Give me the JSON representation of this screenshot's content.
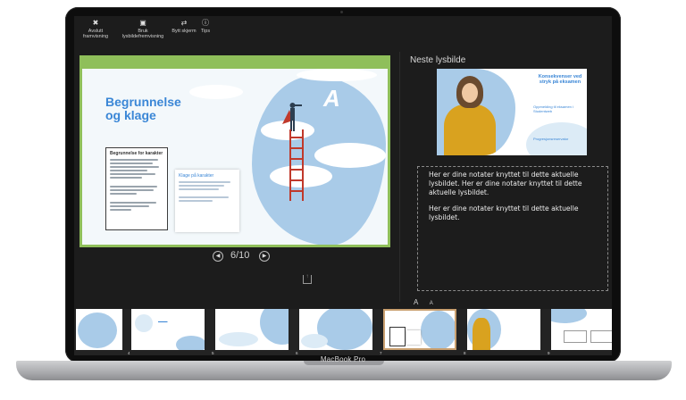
{
  "toolbar": {
    "items": [
      {
        "label": "Avslutt framvisning",
        "icon": "close-circle-icon"
      },
      {
        "label": "Bruk lysbildefremvisning",
        "icon": "screens-icon"
      },
      {
        "label": "Bytt skjerm",
        "icon": "swap-icon"
      },
      {
        "label": "Tips",
        "icon": "info-icon"
      }
    ]
  },
  "current_slide": {
    "title": "Begrunnelse og klage",
    "box1_title": "Begrunnelse for karakter",
    "box2_title": "Klage på karakter"
  },
  "navigation": {
    "position": "6/10",
    "prev_symbol": "◀",
    "next_symbol": "▶"
  },
  "next_slide": {
    "label": "Neste lysbilde",
    "title": "Konsekvenser ved stryk på eksamen",
    "subtitle1": "Oppmelding til eksamen i Studentweb",
    "subtitle2": "Progresjonsreservator"
  },
  "notes": {
    "paragraph1": "Her er dine notater knyttet til dette aktuelle lysbildet. Her er dine notater knyttet til dette aktuelle lysbildet.",
    "paragraph2": "Her er dine notater knyttet til dette aktuelle lysbildet."
  },
  "font_controls": {
    "larger": "A",
    "smaller": "A"
  },
  "filmstrip": {
    "numbers": [
      "",
      "4",
      "5",
      "6",
      "7",
      "8",
      "9",
      ""
    ],
    "active_index": 3
  },
  "device": {
    "label": "MacBook Pro"
  },
  "colors": {
    "accent_green": "#8fbf5a",
    "title_blue": "#3a86d6",
    "cloud_blue": "#a9cbe8"
  }
}
